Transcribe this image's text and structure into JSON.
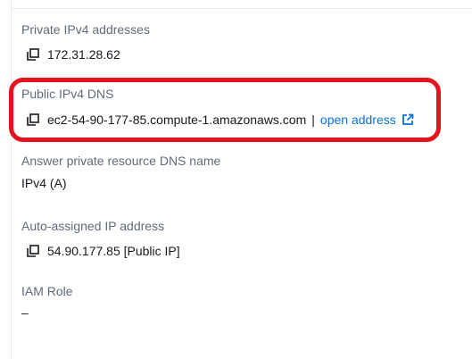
{
  "private_ipv4": {
    "label": "Private IPv4 addresses",
    "value": "172.31.28.62"
  },
  "public_dns": {
    "label": "Public IPv4 DNS",
    "value": "ec2-54-90-177-85.compute-1.amazonaws.com",
    "separator": "|",
    "link_text": "open address"
  },
  "answer_dns": {
    "label": "Answer private resource DNS name",
    "value": "IPv4 (A)"
  },
  "auto_ip": {
    "label": "Auto-assigned IP address",
    "value": "54.90.177.85 [Public IP]"
  },
  "iam_role": {
    "label": "IAM Role",
    "value": "–"
  },
  "colors": {
    "label": "#5f6b7a",
    "text": "#16191f",
    "link": "#0972d3",
    "highlight": "#e3141e"
  },
  "icons": {
    "copy": "copy-icon",
    "external": "external-link-icon"
  }
}
